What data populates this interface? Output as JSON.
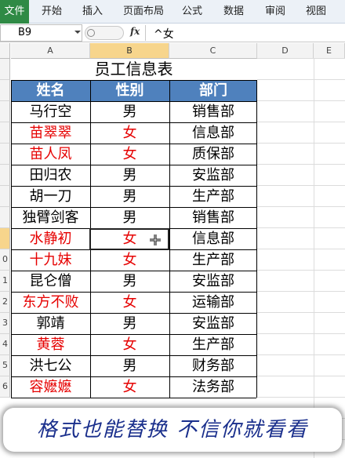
{
  "ribbon": {
    "file_tab": "文件",
    "tabs": [
      "开始",
      "插入",
      "页面布局",
      "公式",
      "数据",
      "审阅",
      "视图"
    ]
  },
  "formula_bar": {
    "name_box": "B9",
    "fx_label": "fx",
    "content": "^女"
  },
  "grid": {
    "columns": [
      "A",
      "B",
      "C",
      "D",
      "E"
    ],
    "row_numbers": [
      "",
      "",
      "",
      "",
      "",
      "",
      "",
      "",
      "",
      "0",
      "1",
      "2",
      "3",
      "4",
      "5",
      "6"
    ],
    "selected_column": "B"
  },
  "table": {
    "title": "员工信息表",
    "headers": [
      "姓名",
      "性别",
      "部门"
    ],
    "rows": [
      {
        "name": "马行空",
        "gender": "男",
        "dept": "销售部",
        "female": false
      },
      {
        "name": "苗翠翠",
        "gender": "女",
        "dept": "信息部",
        "female": true
      },
      {
        "name": "苗人凤",
        "gender": "女",
        "dept": "质保部",
        "female": true
      },
      {
        "name": "田归农",
        "gender": "男",
        "dept": "安监部",
        "female": false
      },
      {
        "name": "胡一刀",
        "gender": "男",
        "dept": "生产部",
        "female": false
      },
      {
        "name": "独臂剑客",
        "gender": "男",
        "dept": "销售部",
        "female": false
      },
      {
        "name": "水静初",
        "gender": "女",
        "dept": "信息部",
        "female": true
      },
      {
        "name": "十九妹",
        "gender": "女",
        "dept": "生产部",
        "female": true
      },
      {
        "name": "昆仑僧",
        "gender": "男",
        "dept": "安监部",
        "female": false
      },
      {
        "name": "东方不败",
        "gender": "女",
        "dept": "运输部",
        "female": true
      },
      {
        "name": "郭靖",
        "gender": "男",
        "dept": "安监部",
        "female": false
      },
      {
        "name": "黄蓉",
        "gender": "女",
        "dept": "生产部",
        "female": true
      },
      {
        "name": "洪七公",
        "gender": "男",
        "dept": "财务部",
        "female": false
      },
      {
        "name": "容嬷嬷",
        "gender": "女",
        "dept": "法务部",
        "female": true
      }
    ]
  },
  "caption": "格式也能替换 不信你就看看",
  "colors": {
    "header_fill": "#4f81bd",
    "female_text": "#e60000",
    "selected_header": "#f7d58c",
    "file_tab": "#2f8a45",
    "caption_text": "#1a2f8c"
  }
}
